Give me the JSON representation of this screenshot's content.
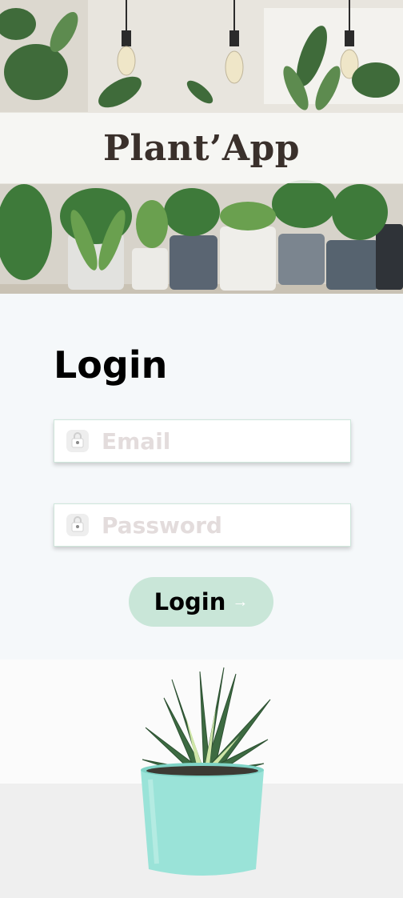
{
  "header": {
    "app_title": "Plant’App"
  },
  "login": {
    "heading": "Login",
    "email": {
      "placeholder": "Email",
      "value": "",
      "icon": "lock-icon"
    },
    "password": {
      "placeholder": "Password",
      "value": "",
      "icon": "lock-icon"
    },
    "button": {
      "label": "Login",
      "arrow": "→",
      "color": "#c9e6d8"
    }
  },
  "colors": {
    "page_background": "#f5f8fa",
    "title_text": "#3a302b",
    "field_border": "#cfe6db",
    "placeholder": "#e3dcdc",
    "pot_teal": "#9ae3d8"
  }
}
